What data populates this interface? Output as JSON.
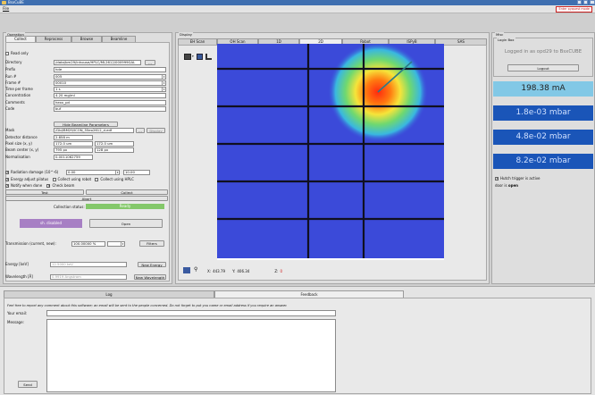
{
  "window": {
    "title": "BsxCuBE",
    "enter_badge": "Enter pyquest mode"
  },
  "menu": {
    "file": "File"
  },
  "operation": {
    "title": "Operation",
    "tabs": [
      "Collect",
      "Reprocess",
      "Browse",
      "Beamline"
    ],
    "read_only": "Read only",
    "fields": [
      {
        "label": "Directory",
        "value": "/data/bm29/inhouse/HPLC/ML2612/000999GAL"
      },
      {
        "label": "Prefix",
        "value": "hde"
      },
      {
        "label": "Run #",
        "value": "005"
      },
      {
        "label": "Frame #",
        "value": "00010"
      },
      {
        "label": "Time per frame",
        "value": "1 s"
      },
      {
        "label": "Concentration",
        "value": "4.20 mg/ml"
      },
      {
        "label": "Comments",
        "value": "hexx_pd"
      },
      {
        "label": "Code",
        "value": "buf"
      }
    ],
    "dir_browse": "...",
    "hide_params": "Hide Beamline Parameters",
    "mask_label": "Mask",
    "mask_value": "/Gbl/BM29/ICON_55eo2612_d.edf",
    "mask_browse": "...",
    "mask_display": "Display",
    "detector_distance_label": "Detector distance",
    "detector_distance": "2.858 m",
    "pixel_size_label": "Pixel size (x, y)",
    "pixel_x": "172.0 um",
    "pixel_y": "172.0 um",
    "beam_center_label": "Beam center (x, y)",
    "beam_x": "795 px",
    "beam_y": "128 px",
    "normalisation_label": "Normalisation",
    "normalisation": "0.0011062759",
    "radiation_label": "Radiation damage (10^-6)",
    "rad_a": "0.00",
    "rad_b": "10.00",
    "energy_pilatus": "Energy adjust pilatus",
    "collect_robot": "Collect using robot",
    "collect_hplc": "Collect using HPLC",
    "notify_done": "Notify when done",
    "check_beam": "Check beam",
    "test_button": "Test",
    "collect_button": "Collect",
    "abort_button": "Abort",
    "collection_status_label": "Collection status:",
    "collection_status": "Ready",
    "shutter_state": "sh. disabled",
    "open_button": "Open",
    "transmission_label": "Transmission (current, new):",
    "transmission_value": "100.00000 %",
    "filters_button": "Filters",
    "energy_label": "Energy [keV]",
    "energy_value": "12.5000 keV",
    "new_energy_button": "New Energy",
    "wavelength_label": "Wavelength [Å]",
    "wavelength_value": "0.9919 Angstrom",
    "new_wavelength_button": "New Wavelength"
  },
  "display": {
    "title": "Display",
    "tabs": [
      "EH Scan",
      "OH Scan",
      "1D",
      "2D",
      "Robot",
      "ISPyB",
      "SAS"
    ],
    "zoom": "55%",
    "x_label": "X:",
    "x_value": "443.79",
    "y_label": "Y:",
    "y_value": "406.34",
    "z_label": "Z:",
    "z_value": "0",
    "colors": {
      "detector_bg": "#3b4ad9",
      "spot_center": "#ff2a10"
    }
  },
  "misc": {
    "title": "Misc",
    "login_title": "Login Box",
    "logged_in": "Logged in as opd29 to BsxCUBE",
    "logout": "Logout",
    "current": "198.38 mA",
    "vacuum": [
      "1.8e-03 mbar",
      "4.8e-02 mbar",
      "8.2e-02 mbar"
    ],
    "hutch_trigger": "Hutch trigger is active",
    "door_prefix": "door is ",
    "door_state": "open"
  },
  "bottom": {
    "tabs": [
      "Log",
      "Feedback"
    ],
    "info": "Feel free to report any comment about this software; an email will be sent to the people concerned. Do not forget to put you name or email address if you require an answer.",
    "email_label": "Your email:",
    "message_label": "Message:",
    "send": "Send"
  }
}
